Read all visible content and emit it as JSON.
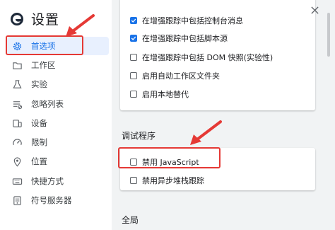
{
  "app": {
    "title": "设置"
  },
  "sidebar": {
    "items": [
      {
        "label": "首选项",
        "icon": "gear-icon",
        "active": true
      },
      {
        "label": "工作区",
        "icon": "folder-icon"
      },
      {
        "label": "实验",
        "icon": "flask-icon"
      },
      {
        "label": "忽略列表",
        "icon": "list-icon"
      },
      {
        "label": "设备",
        "icon": "device-icon"
      },
      {
        "label": "限制",
        "icon": "gauge-icon"
      },
      {
        "label": "位置",
        "icon": "location-icon"
      },
      {
        "label": "快捷方式",
        "icon": "keyboard-icon"
      },
      {
        "label": "符号服务器",
        "icon": "server-icon"
      }
    ]
  },
  "sources": {
    "options": [
      {
        "label": "在增强跟踪中包括控制台消息",
        "checked": true
      },
      {
        "label": "在增强跟踪中包括脚本源",
        "checked": true
      },
      {
        "label": "在增强跟踪中包括 DOM 快照(实验性)",
        "checked": false
      },
      {
        "label": "启用自动工作区文件夹",
        "checked": false
      },
      {
        "label": "启用本地替代",
        "checked": false
      }
    ]
  },
  "debugger": {
    "title": "调试程序",
    "options": [
      {
        "label": "禁用 JavaScript",
        "checked": false
      },
      {
        "label": "禁用异步堆栈跟踪",
        "checked": false
      }
    ]
  },
  "global": {
    "title": "全局"
  },
  "colors": {
    "accent": "#1a73e8",
    "annotation": "#e53935",
    "panel_bg": "#f1f3f4"
  }
}
